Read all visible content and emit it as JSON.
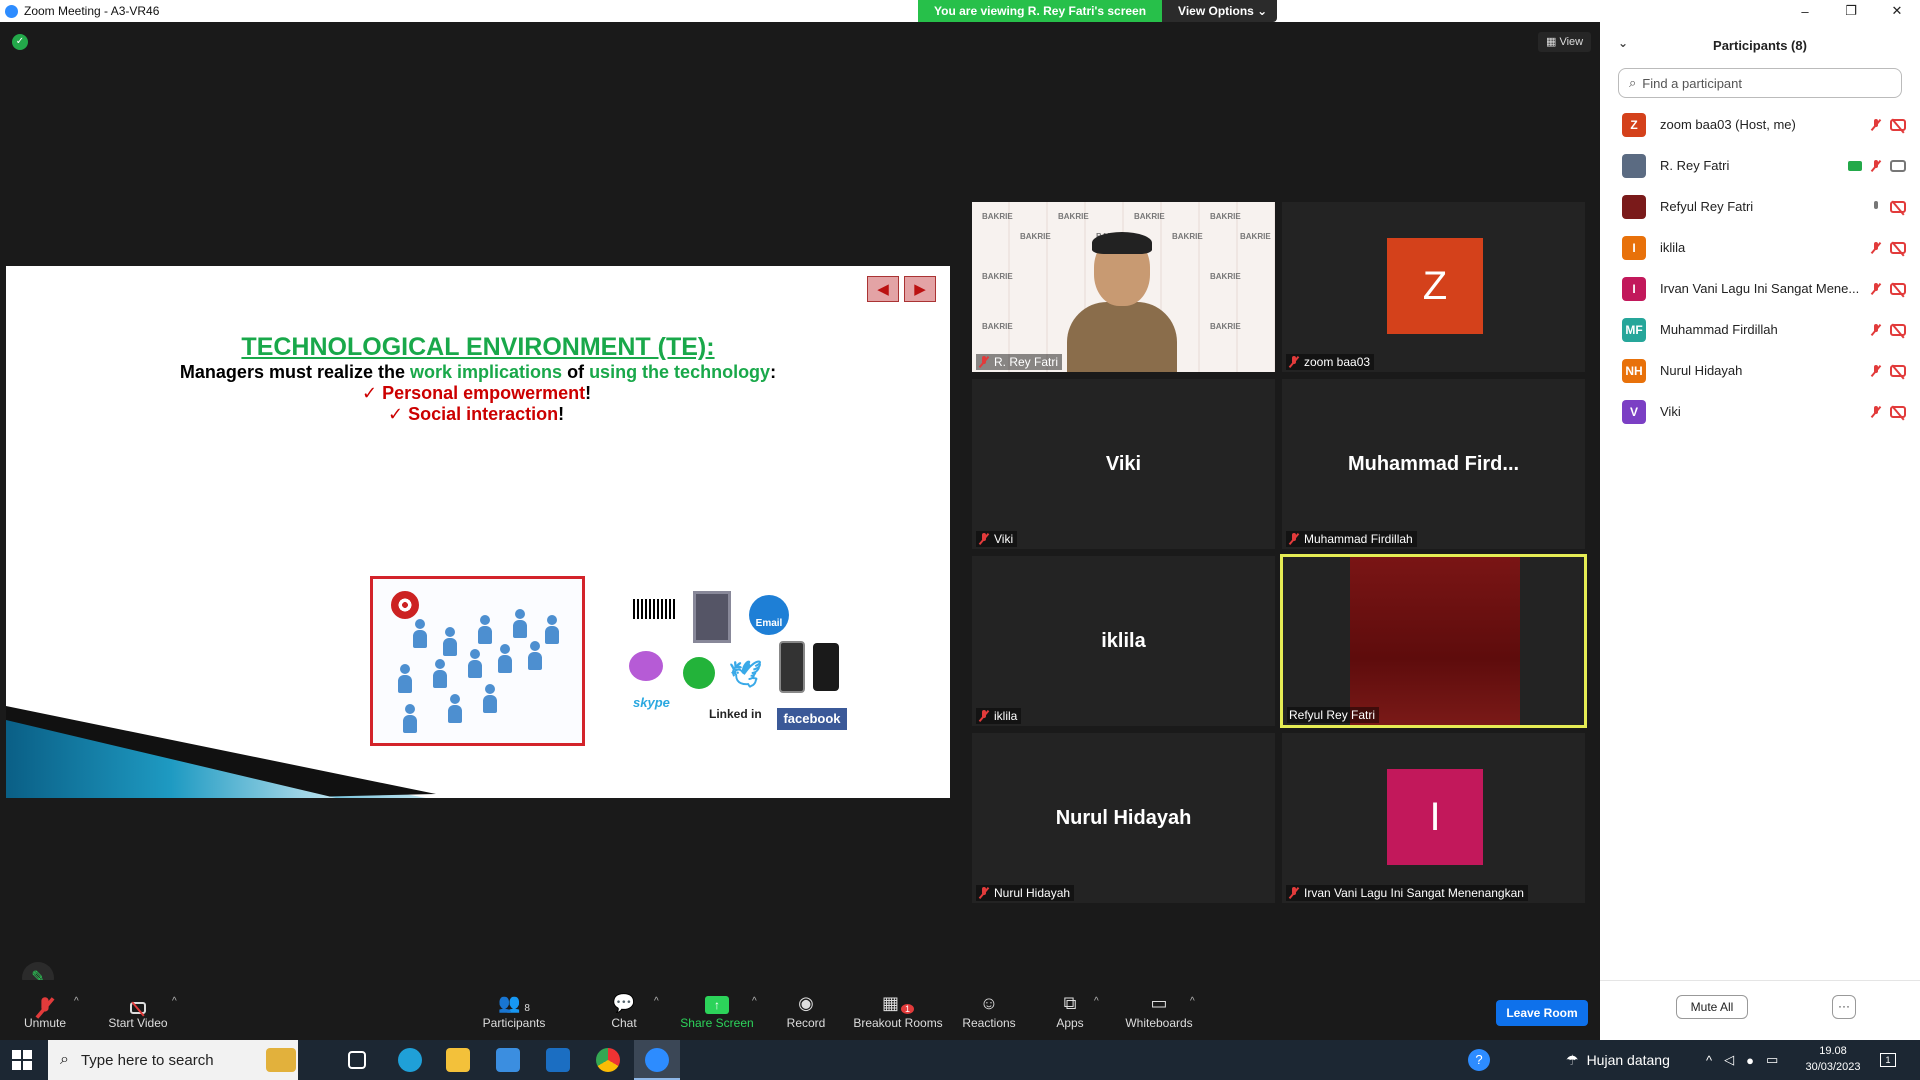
{
  "window": {
    "title": "Zoom Meeting - A3-VR46",
    "minimize": "–",
    "restore": "❐",
    "close": "✕"
  },
  "share_banner": {
    "message": "You are viewing R. Rey Fatri's screen",
    "view_options": "View Options ⌄"
  },
  "top_right": {
    "view_label": "▦ View"
  },
  "slide": {
    "title": "TECHNOLOGICAL ENVIRONMENT (TE):",
    "subtitle_a": "Managers must realize the ",
    "subtitle_b": "work implications",
    "subtitle_c": " of ",
    "subtitle_d": "using the technology",
    "subtitle_e": ":",
    "bullet1": "Personal empowerment",
    "bullet2": "Social interaction",
    "check": "✓",
    "bang": "!",
    "icon_labels": {
      "email": "Email",
      "skype": "skype",
      "linkedin": "Linked in",
      "facebook": "facebook"
    }
  },
  "tiles": [
    {
      "name": "R. Rey Fatri",
      "type": "video"
    },
    {
      "name": "zoom baa03",
      "type": "avatar",
      "initial": "Z",
      "color": "#d4411b"
    },
    {
      "name": "Viki",
      "type": "name",
      "big": "Viki"
    },
    {
      "name": "Muhammad Firdillah",
      "type": "name",
      "big": "Muhammad  Fird..."
    },
    {
      "name": "iklila",
      "type": "name",
      "big": "iklila"
    },
    {
      "name": "Refyul Rey Fatri",
      "type": "video-red",
      "active": true
    },
    {
      "name": "Nurul Hidayah",
      "type": "name",
      "big": "Nurul Hidayah"
    },
    {
      "name": "Irvan Vani Lagu Ini Sangat Menenangkan",
      "type": "avatar",
      "initial": "I",
      "color": "#c2185b"
    }
  ],
  "bakrie_text": "BAKRIE",
  "controls": {
    "unmute": "Unmute",
    "start_video": "Start Video",
    "participants": "Participants",
    "participants_count": "8",
    "chat": "Chat",
    "share_screen": "Share Screen",
    "record": "Record",
    "breakout_rooms": "Breakout Rooms",
    "breakout_badge": "1",
    "reactions": "Reactions",
    "apps": "Apps",
    "whiteboards": "Whiteboards",
    "leave_room": "Leave Room"
  },
  "panel": {
    "title": "Participants (8)",
    "search_placeholder": "Find a participant",
    "participants": [
      {
        "initials": "Z",
        "name": "zoom baa03 (Host, me)",
        "color": "#d4411b",
        "mic": "off",
        "video": "off"
      },
      {
        "initials": "",
        "name": "R. Rey Fatri",
        "color": "#5b6b82",
        "mic": "off",
        "video": "on",
        "sharing": true
      },
      {
        "initials": "",
        "name": "Refyul Rey Fatri",
        "color": "#7a1a1a",
        "mic": "on",
        "video": "off"
      },
      {
        "initials": "I",
        "name": "iklila",
        "color": "#e8710a",
        "mic": "off",
        "video": "off"
      },
      {
        "initials": "I",
        "name": "Irvan Vani Lagu Ini Sangat Mene...",
        "color": "#c2185b",
        "mic": "off",
        "video": "off"
      },
      {
        "initials": "MF",
        "name": "Muhammad Firdillah",
        "color": "#26a69a",
        "mic": "off",
        "video": "off"
      },
      {
        "initials": "NH",
        "name": "Nurul Hidayah",
        "color": "#e8710a",
        "mic": "off",
        "video": "off"
      },
      {
        "initials": "V",
        "name": "Viki",
        "color": "#7b3fc4",
        "mic": "off",
        "video": "off"
      }
    ],
    "mute_all": "Mute All",
    "more": "···"
  },
  "taskbar": {
    "search_placeholder": "Type here to search",
    "weather": "Hujan datang",
    "time": "19.08",
    "date": "30/03/2023",
    "notif_count": "1"
  }
}
